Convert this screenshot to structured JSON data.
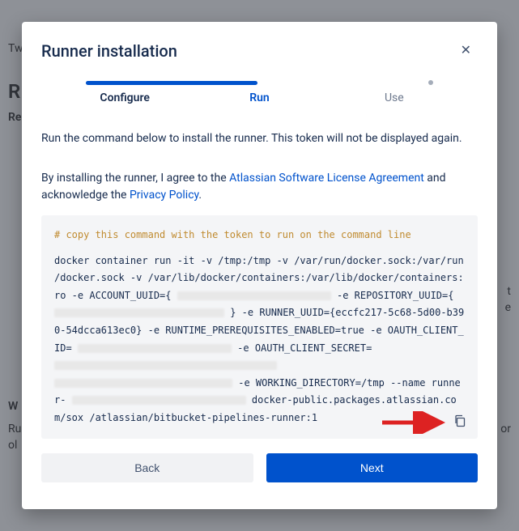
{
  "modal": {
    "title": "Runner installation",
    "steps": {
      "configure": "Configure",
      "run": "Run",
      "use": "Use"
    },
    "line1": "Run the command below to install the runner. This token will not be displayed again.",
    "agree_prefix": "By installing the runner, I agree to the ",
    "license_link": "Atlassian Software License Agreement",
    "agree_mid": " and acknowledge the ",
    "privacy_link": "Privacy Policy",
    "agree_suffix": ".",
    "code": {
      "comment": "# copy this command with the token to run on the command line",
      "seg1": "docker container run -it -v /tmp:/tmp -v /var/run/docker.sock:/var/run /docker.sock -v /var/lib/docker/containers:/var/lib/docker/containers:ro -e ACCOUNT_UUID={",
      "seg2": " -e REPOSITORY_UUID={",
      "seg3": "} -e RUNNER_UUID={eccfc217-5c68-5d00-b390-54dcca613ec0} -e RUNTIME_PREREQUISITES_ENABLED=true -e OAUTH_CLIENT_ID=",
      "seg4": " -e OAUTH_CLIENT_SECRET=",
      "seg5": " -e WORKING_DIRECTORY=/tmp --name runner-",
      "seg6": " docker-public.packages.atlassian.com/sox /atlassian/bitbucket-pipelines-runner:1"
    },
    "buttons": {
      "back": "Back",
      "next": "Next"
    }
  },
  "bg": {
    "t1": "Tw",
    "t2": "R",
    "t3": "Re",
    "t4": "W",
    "t5": "Ru",
    "t6": "ol",
    "r1": "t",
    "r2": "e",
    "r3": "or"
  }
}
